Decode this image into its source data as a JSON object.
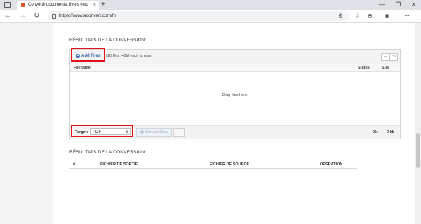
{
  "browser": {
    "tab_title": "Convertir documents, livres élec",
    "tab_close": "×",
    "new_tab": "+",
    "url": "https://www.aconvert.com/fr/",
    "window_controls": [
      "—",
      "❐",
      "✕"
    ]
  },
  "page": {
    "section_heading_top": "RÉSULTATS DE LA CONVERSION:",
    "uploader": {
      "add_files": "Add Files",
      "limits": "(10 files, 40M each at max)",
      "columns": {
        "filename": "Filename",
        "status": "Status",
        "size": "Size"
      },
      "drop_text": "Drag files here.",
      "target_label": "Target:",
      "target_value": "PDF",
      "convert_label": "Convert Now",
      "progress": "0%",
      "total_size": "0 kb"
    },
    "section_heading_bottom": "RÉSULTATS DE LA CONVERSION:",
    "results_columns": [
      "#",
      "FICHIER DE SORTIE",
      "FICHIER DE SOURCE",
      "OPÉRATION"
    ]
  },
  "colors": {
    "highlight": "#e0121b",
    "link": "#3266a8"
  }
}
